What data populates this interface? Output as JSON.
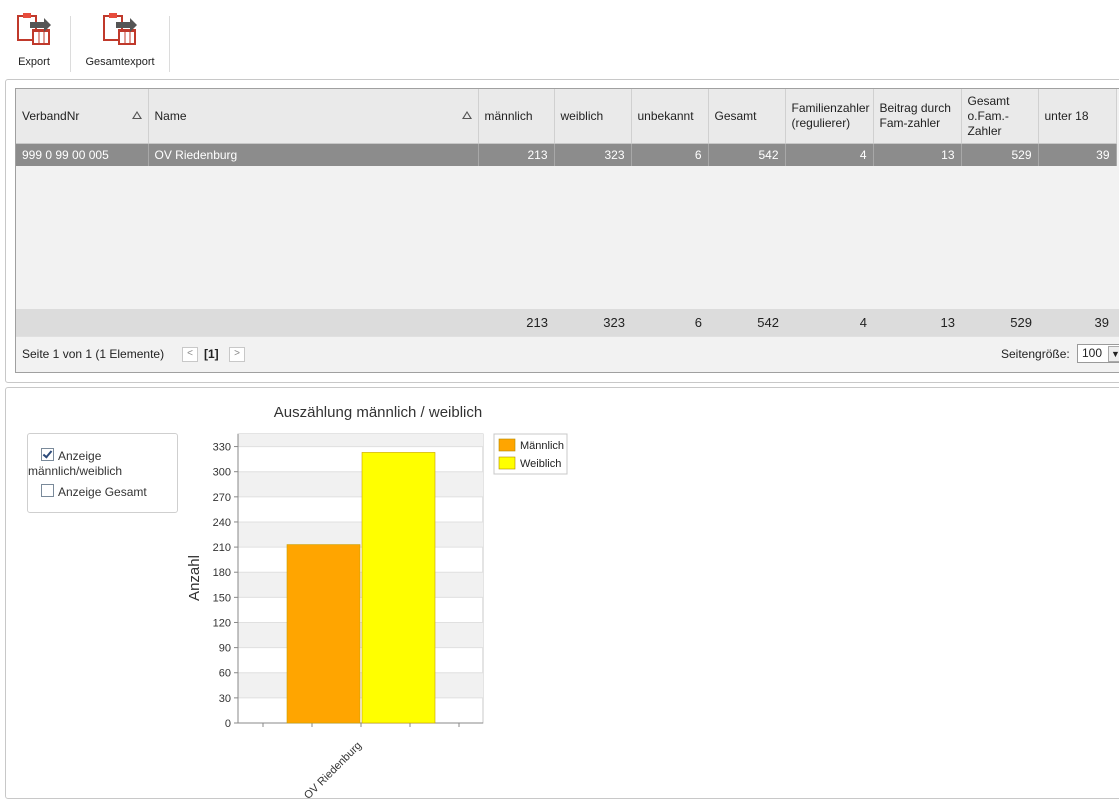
{
  "toolbar": {
    "export_label": "Export",
    "gesamtexport_label": "Gesamtexport"
  },
  "grid": {
    "columns": [
      "VerbandNr",
      "Name",
      "männlich",
      "weiblich",
      "unbekannt",
      "Gesamt",
      "Familienzahler (regulierer)",
      "Beitrag durch Fam-zahler",
      "Gesamt o.Fam.-Zahler",
      "unter 18"
    ],
    "rows": [
      [
        "999 0 99 00 005",
        "OV Riedenburg",
        "213",
        "323",
        "6",
        "542",
        "4",
        "13",
        "529",
        "39"
      ]
    ],
    "totals": [
      "213",
      "323",
      "6",
      "542",
      "4",
      "13",
      "529",
      "39"
    ],
    "pager": {
      "text": "Seite 1 von 1 (1 Elemente)",
      "current": "[1]",
      "page_size_label": "Seitengröße:",
      "page_size": "100"
    }
  },
  "options": {
    "show_mw_label": "Anzeige männlich/weiblich",
    "show_mw_checked": true,
    "show_total_label": "Anzeige Gesamt",
    "show_total_checked": false
  },
  "chart_data": {
    "type": "bar",
    "title": "Auszählung männlich / weiblich",
    "ylabel": "Anzahl",
    "xlabel": "",
    "categories": [
      "OV Riedenburg"
    ],
    "series": [
      {
        "name": "Männlich",
        "values": [
          213
        ],
        "color": "#FFA500"
      },
      {
        "name": "Weiblich",
        "values": [
          323
        ],
        "color": "#FFFF00"
      }
    ],
    "ylim": [
      0,
      345
    ],
    "yticks": [
      0,
      30,
      60,
      90,
      120,
      150,
      180,
      210,
      240,
      270,
      300,
      330
    ],
    "legend": "top-right",
    "grid": true
  }
}
